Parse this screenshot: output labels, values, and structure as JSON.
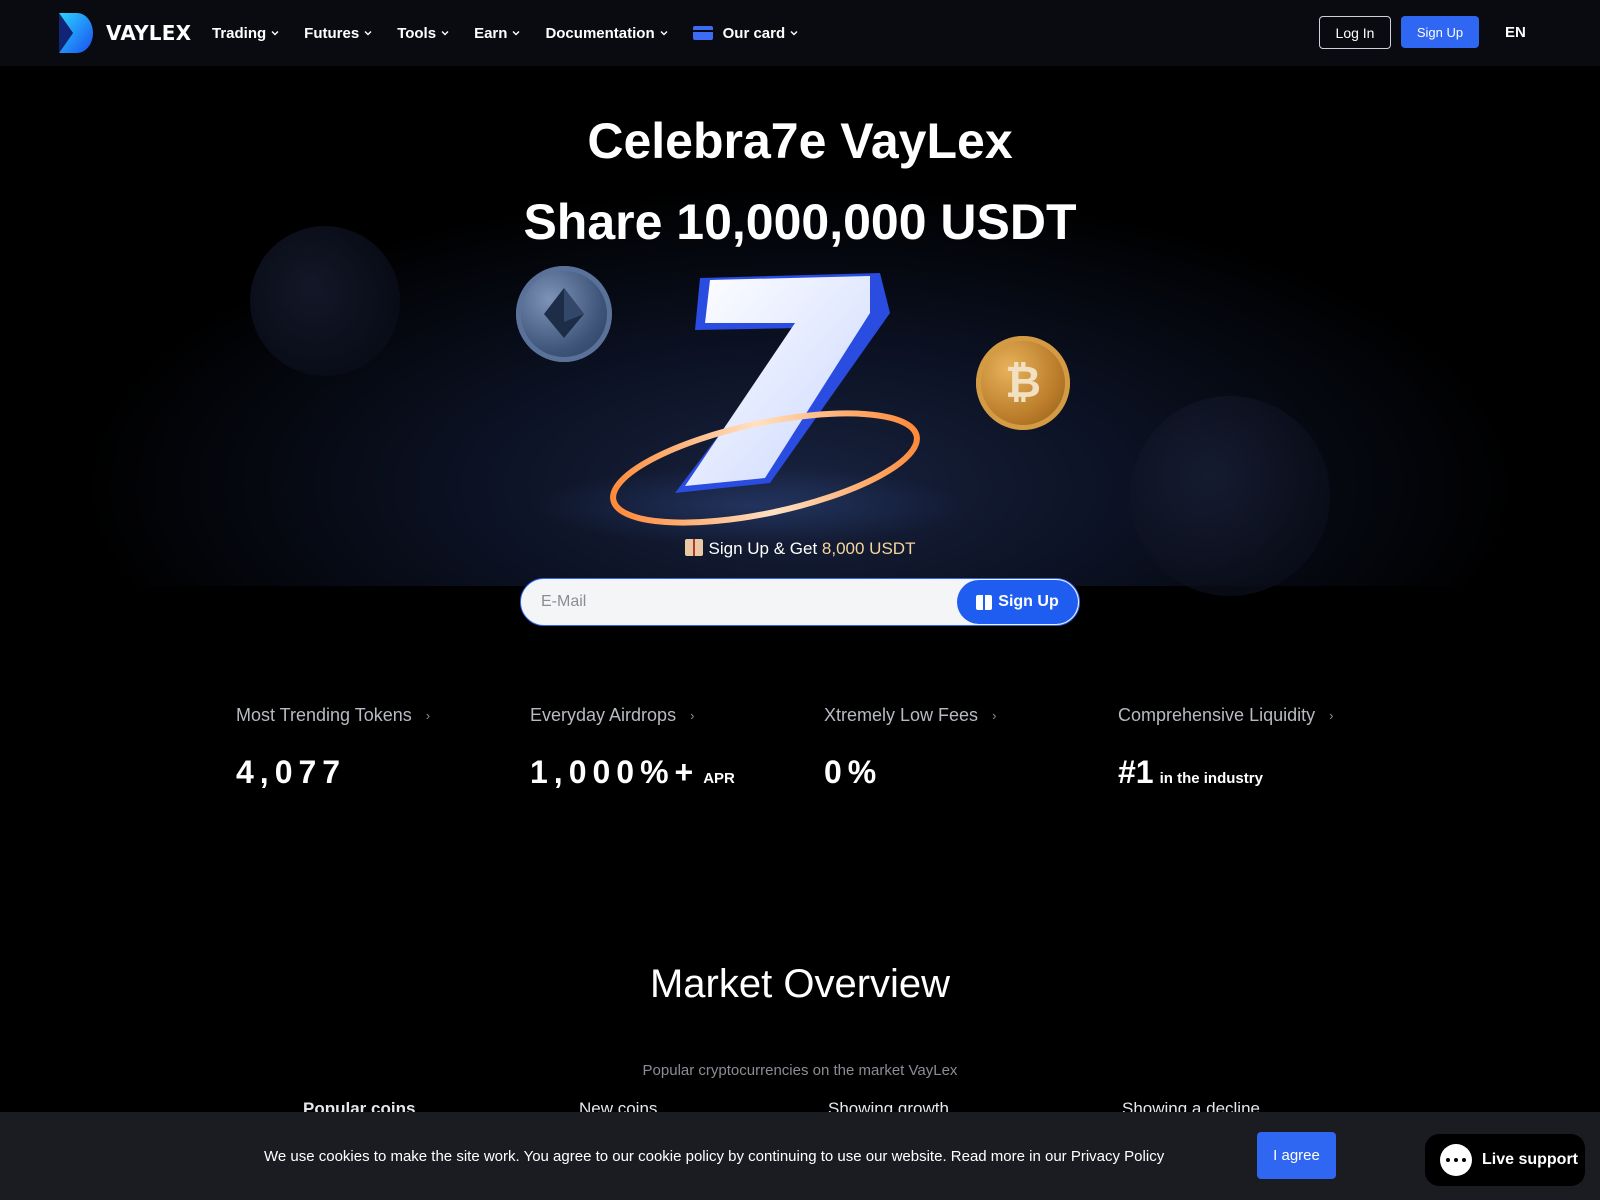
{
  "header": {
    "brand": "VAYLEX",
    "nav": [
      {
        "label": "Trading"
      },
      {
        "label": "Futures"
      },
      {
        "label": "Tools"
      },
      {
        "label": "Earn"
      },
      {
        "label": "Documentation"
      },
      {
        "label": "Our card",
        "icon": "credit-card-icon"
      }
    ],
    "login_label": "Log In",
    "signup_label": "Sign Up",
    "language": "EN"
  },
  "hero": {
    "title_line1": "Celebra7e VayLex",
    "title_line2": "Share 10,000,000 USDT",
    "promo_prefix": "Sign Up & Get",
    "promo_amount": "8,000 USDT",
    "email_placeholder": "E-Mail",
    "signup_button_label": "Sign Up"
  },
  "stats": [
    {
      "label": "Most Trending Tokens",
      "value": "4,077",
      "suffix": ""
    },
    {
      "label": "Everyday Airdrops",
      "value": "1,000%+",
      "suffix": "APR"
    },
    {
      "label": "Xtremely Low Fees",
      "value": "0%",
      "suffix": ""
    },
    {
      "label": "Comprehensive Liquidity",
      "value": "#1",
      "suffix": "in the industry"
    }
  ],
  "market": {
    "title": "Market Overview",
    "subtitle": "Popular cryptocurrencies on the market VayLex",
    "tabs": [
      {
        "label": "Popular coins"
      },
      {
        "label": "New coins"
      },
      {
        "label": "Showing growth"
      },
      {
        "label": "Showing a decline"
      }
    ]
  },
  "cookie": {
    "text": "We use cookies to make the site work. You agree to our cookie policy by continuing to use our website. Read more in our Privacy Policy",
    "agree_label": "I agree"
  },
  "support": {
    "label": "Live support"
  },
  "colors": {
    "accent": "#2f66f2",
    "background": "#000000",
    "header": "#0a0b10",
    "promo_amount": "#f5d59a"
  }
}
